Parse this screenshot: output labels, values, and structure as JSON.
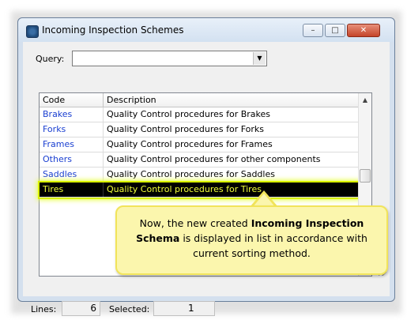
{
  "window": {
    "title": "Incoming Inspection Schemes",
    "buttons": {
      "minimize": "–",
      "maximize": "□",
      "close": "✕"
    }
  },
  "query": {
    "label": "Query:",
    "value": "",
    "dropdown_glyph": "▼"
  },
  "list": {
    "columns": [
      "Code",
      "Description"
    ],
    "rows": [
      {
        "code": "Brakes",
        "description": "Quality Control procedures for Brakes"
      },
      {
        "code": "Forks",
        "description": "Quality Control procedures for Forks"
      },
      {
        "code": "Frames",
        "description": "Quality Control procedures for Frames"
      },
      {
        "code": "Others",
        "description": "Quality Control procedures for other components"
      },
      {
        "code": "Saddles",
        "description": "Quality Control procedures for Saddles"
      },
      {
        "code": "Tires",
        "description": "Quality Control procedures for Tires"
      }
    ],
    "selected_index": 5,
    "scroll_up_glyph": "▲"
  },
  "callout": {
    "part1": "Now, the new created ",
    "bold": "Incoming Inspection Schema",
    "part2": " is displayed in list in accordance with current sorting method."
  },
  "status": {
    "lines_label": "Lines:",
    "lines_value": "6",
    "selected_label": "Selected:",
    "selected_value": "1"
  },
  "colors": {
    "code_link": "#1a3fd1",
    "selection_bg": "#000000",
    "selection_text": "#f2ff3a",
    "highlight_glow": "#e6ff3c",
    "callout_bg": "#fbf6ad"
  }
}
